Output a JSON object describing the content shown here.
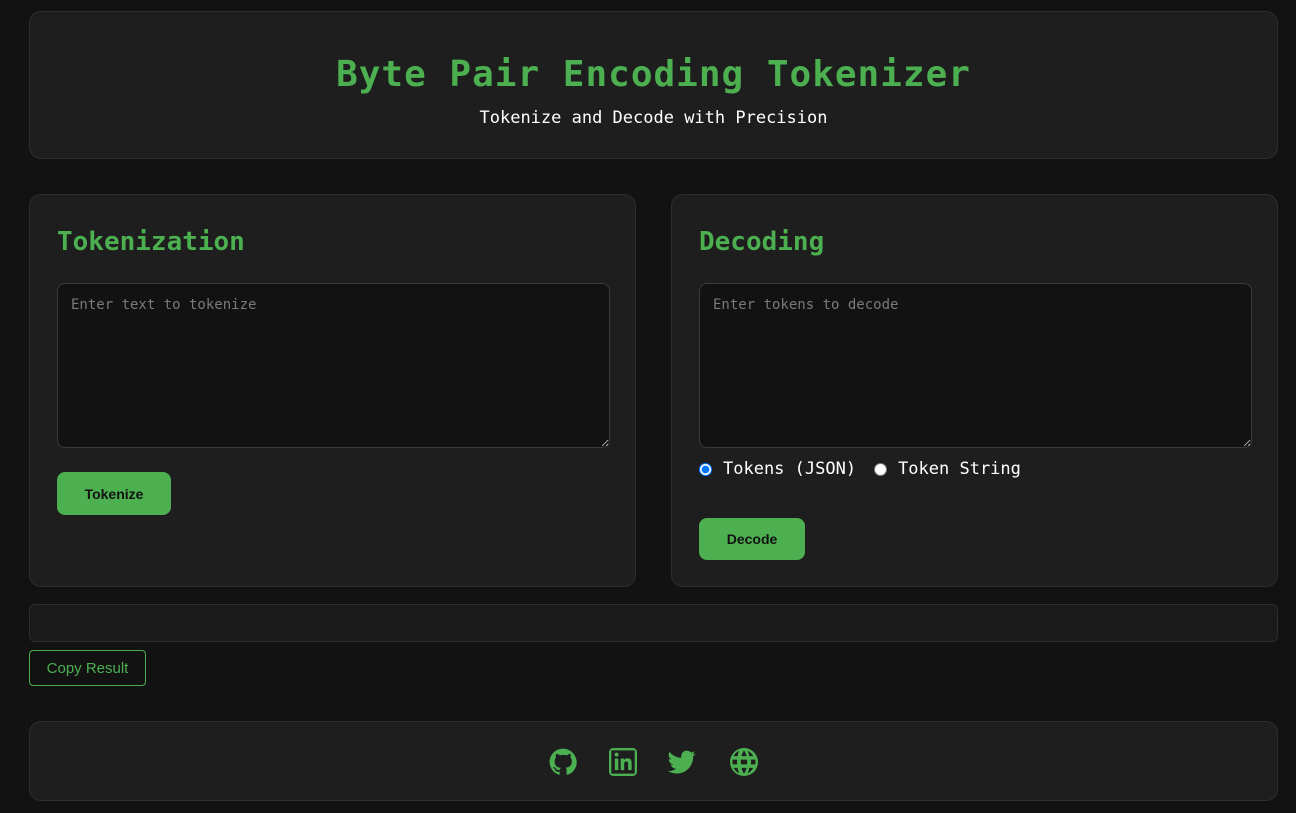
{
  "header": {
    "title": "Byte Pair Encoding Tokenizer",
    "subtitle": "Tokenize and Decode with Precision"
  },
  "tokenization": {
    "title": "Tokenization",
    "input_placeholder": "Enter text to tokenize",
    "input_value": "",
    "button_label": "Tokenize"
  },
  "decoding": {
    "title": "Decoding",
    "input_placeholder": "Enter tokens to decode",
    "input_value": "",
    "radio_options": [
      {
        "label": "Tokens (JSON)",
        "checked": true
      },
      {
        "label": "Token String",
        "checked": false
      }
    ],
    "button_label": "Decode"
  },
  "result": {
    "value": "",
    "copy_label": "Copy Result"
  },
  "footer": {
    "links": [
      {
        "icon": "github-icon"
      },
      {
        "icon": "linkedin-icon"
      },
      {
        "icon": "twitter-icon"
      },
      {
        "icon": "globe-icon"
      }
    ]
  },
  "colors": {
    "accent": "#4caf50",
    "background": "#121212",
    "card": "#1e1e1e"
  }
}
